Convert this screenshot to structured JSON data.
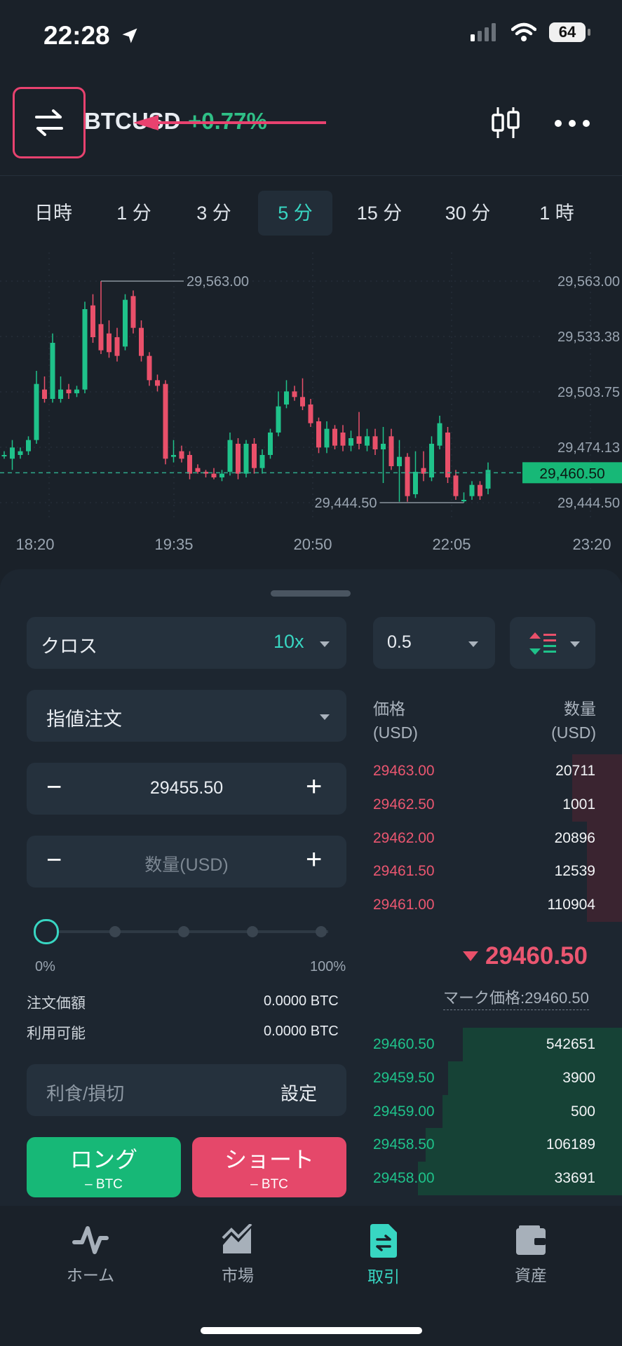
{
  "status": {
    "time": "22:28",
    "battery": "64"
  },
  "header": {
    "pair": "BTCUSD",
    "change": "+0.77%"
  },
  "timeframes": [
    {
      "label": "日時",
      "active": false
    },
    {
      "label": "1 分",
      "active": false
    },
    {
      "label": "3 分",
      "active": false
    },
    {
      "label": "5 分",
      "active": true
    },
    {
      "label": "15 分",
      "active": false
    },
    {
      "label": "30 分",
      "active": false
    },
    {
      "label": "1 時",
      "active": false
    }
  ],
  "chart_data": {
    "type": "candlestick",
    "y_ticks": [
      "29,563.00",
      "29,533.38",
      "29,503.75",
      "29,474.13",
      "29,444.50"
    ],
    "y_tick_values": [
      29563.0,
      29533.38,
      29503.75,
      29474.13,
      29444.5
    ],
    "x_ticks": [
      "18:20",
      "19:35",
      "20:50",
      "22:05",
      "23:20"
    ],
    "current_price": "29,460.50",
    "current_price_value": 29460.5,
    "high_label": "29,563.00",
    "high_value": 29563.0,
    "low_label": "29,444.50",
    "low_value": 29444.5,
    "ylim": [
      29444.5,
      29563.0
    ],
    "candles": [
      {
        "o": 29470,
        "c": 29470,
        "h": 29472,
        "l": 29468
      },
      {
        "o": 29468,
        "c": 29474,
        "h": 29478,
        "l": 29462
      },
      {
        "o": 29470,
        "c": 29472,
        "h": 29474,
        "l": 29468
      },
      {
        "o": 29472,
        "c": 29478,
        "h": 29480,
        "l": 29470
      },
      {
        "o": 29478,
        "c": 29508,
        "h": 29515,
        "l": 29476
      },
      {
        "o": 29505,
        "c": 29500,
        "h": 29512,
        "l": 29498
      },
      {
        "o": 29500,
        "c": 29530,
        "h": 29535,
        "l": 29498
      },
      {
        "o": 29500,
        "c": 29505,
        "h": 29512,
        "l": 29498
      },
      {
        "o": 29505,
        "c": 29503,
        "h": 29508,
        "l": 29500
      },
      {
        "o": 29503,
        "c": 29505,
        "h": 29507,
        "l": 29501
      },
      {
        "o": 29505,
        "c": 29548,
        "h": 29552,
        "l": 29503
      },
      {
        "o": 29550,
        "c": 29533,
        "h": 29556,
        "l": 29530
      },
      {
        "o": 29540,
        "c": 29526,
        "h": 29563,
        "l": 29524
      },
      {
        "o": 29535,
        "c": 29525,
        "h": 29542,
        "l": 29522
      },
      {
        "o": 29533,
        "c": 29523,
        "h": 29538,
        "l": 29520
      },
      {
        "o": 29528,
        "c": 29553,
        "h": 29556,
        "l": 29526
      },
      {
        "o": 29555,
        "c": 29538,
        "h": 29558,
        "l": 29535
      },
      {
        "o": 29538,
        "c": 29523,
        "h": 29542,
        "l": 29520
      },
      {
        "o": 29523,
        "c": 29510,
        "h": 29525,
        "l": 29507
      },
      {
        "o": 29510,
        "c": 29507,
        "h": 29513,
        "l": 29504
      },
      {
        "o": 29508,
        "c": 29468,
        "h": 29510,
        "l": 29465
      },
      {
        "o": 29469,
        "c": 29470,
        "h": 29478,
        "l": 29466
      },
      {
        "o": 29472,
        "c": 29468,
        "h": 29475,
        "l": 29466
      },
      {
        "o": 29470,
        "c": 29460,
        "h": 29472,
        "l": 29457
      },
      {
        "o": 29463,
        "c": 29461,
        "h": 29465,
        "l": 29460
      },
      {
        "o": 29461,
        "c": 29460,
        "h": 29462,
        "l": 29458
      },
      {
        "o": 29460,
        "c": 29458,
        "h": 29463,
        "l": 29457
      },
      {
        "o": 29458,
        "c": 29460,
        "h": 29462,
        "l": 29456
      },
      {
        "o": 29461,
        "c": 29478,
        "h": 29482,
        "l": 29459
      },
      {
        "o": 29476,
        "c": 29460,
        "h": 29479,
        "l": 29457
      },
      {
        "o": 29460,
        "c": 29476,
        "h": 29478,
        "l": 29458
      },
      {
        "o": 29476,
        "c": 29463,
        "h": 29479,
        "l": 29460
      },
      {
        "o": 29463,
        "c": 29470,
        "h": 29473,
        "l": 29460
      },
      {
        "o": 29470,
        "c": 29482,
        "h": 29484,
        "l": 29468
      },
      {
        "o": 29482,
        "c": 29496,
        "h": 29504,
        "l": 29480
      },
      {
        "o": 29497,
        "c": 29504,
        "h": 29510,
        "l": 29495
      },
      {
        "o": 29504,
        "c": 29501,
        "h": 29507,
        "l": 29499
      },
      {
        "o": 29501,
        "c": 29496,
        "h": 29511,
        "l": 29494
      },
      {
        "o": 29497,
        "c": 29487,
        "h": 29500,
        "l": 29485
      },
      {
        "o": 29488,
        "c": 29474,
        "h": 29490,
        "l": 29471
      },
      {
        "o": 29474,
        "c": 29484,
        "h": 29488,
        "l": 29471
      },
      {
        "o": 29484,
        "c": 29475,
        "h": 29486,
        "l": 29473
      },
      {
        "o": 29482,
        "c": 29475,
        "h": 29486,
        "l": 29472
      },
      {
        "o": 29475,
        "c": 29479,
        "h": 29483,
        "l": 29472
      },
      {
        "o": 29480,
        "c": 29476,
        "h": 29493,
        "l": 29473
      },
      {
        "o": 29475,
        "c": 29480,
        "h": 29484,
        "l": 29472
      },
      {
        "o": 29480,
        "c": 29473,
        "h": 29484,
        "l": 29470
      },
      {
        "o": 29473,
        "c": 29476,
        "h": 29485,
        "l": 29455
      },
      {
        "o": 29480,
        "c": 29464,
        "h": 29484,
        "l": 29462
      },
      {
        "o": 29464,
        "c": 29469,
        "h": 29478,
        "l": 29445
      },
      {
        "o": 29469,
        "c": 29448,
        "h": 29471,
        "l": 29445
      },
      {
        "o": 29449,
        "c": 29461,
        "h": 29472,
        "l": 29447
      },
      {
        "o": 29463,
        "c": 29460,
        "h": 29472,
        "l": 29456
      },
      {
        "o": 29458,
        "c": 29476,
        "h": 29480,
        "l": 29456
      },
      {
        "o": 29475,
        "c": 29487,
        "h": 29491,
        "l": 29473
      },
      {
        "o": 29482,
        "c": 29458,
        "h": 29485,
        "l": 29455
      },
      {
        "o": 29459,
        "c": 29448,
        "h": 29462,
        "l": 29446
      },
      {
        "o": 29446,
        "c": 29446,
        "h": 29450,
        "l": 29444.5
      },
      {
        "o": 29448,
        "c": 29454,
        "h": 29456,
        "l": 29446
      },
      {
        "o": 29454,
        "c": 29448,
        "h": 29456,
        "l": 29446
      },
      {
        "o": 29452,
        "c": 29462,
        "h": 29466,
        "l": 29449
      }
    ]
  },
  "order": {
    "margin_mode": "クロス",
    "leverage": "10x",
    "order_type": "指値注文",
    "price": "29455.50",
    "qty_placeholder": "数量(USD)",
    "slider_min": "0%",
    "slider_max": "100%",
    "slider_fraction": 0,
    "order_value_label": "注文価額",
    "order_value": "0.0000 BTC",
    "available_label": "利用可能",
    "available": "0.0000 BTC",
    "tpsl_label": "利食/損切",
    "tpsl_set": "設定",
    "long_label": "ロング",
    "long_sub": "– BTC",
    "short_label": "ショート",
    "short_sub": "– BTC"
  },
  "orderbook": {
    "depth_select": "0.5",
    "col_price": "価格",
    "col_price_unit": "(USD)",
    "col_qty": "数量",
    "col_qty_unit": "(USD)",
    "asks": [
      {
        "price": "29463.00",
        "qty": "20711",
        "depth": 0.2
      },
      {
        "price": "29462.50",
        "qty": "1001",
        "depth": 0.2
      },
      {
        "price": "29462.00",
        "qty": "20896",
        "depth": 0.14
      },
      {
        "price": "29461.50",
        "qty": "12539",
        "depth": 0.14
      },
      {
        "price": "29461.00",
        "qty": "110904",
        "depth": 0.14
      }
    ],
    "last_price": "29460.50",
    "mark_price": "マーク価格:29460.50",
    "bids": [
      {
        "price": "29460.50",
        "qty": "542651",
        "depth": 0.64
      },
      {
        "price": "29459.50",
        "qty": "3900",
        "depth": 0.7
      },
      {
        "price": "29459.00",
        "qty": "500",
        "depth": 0.72
      },
      {
        "price": "29458.50",
        "qty": "106189",
        "depth": 0.79
      },
      {
        "price": "29458.00",
        "qty": "33691",
        "depth": 0.82
      }
    ]
  },
  "tabs": [
    {
      "label": "ホーム",
      "active": false,
      "icon": "home-pulse-icon"
    },
    {
      "label": "市場",
      "active": false,
      "icon": "market-chart-icon"
    },
    {
      "label": "取引",
      "active": true,
      "icon": "trade-doc-icon"
    },
    {
      "label": "資産",
      "active": false,
      "icon": "wallet-icon"
    }
  ],
  "colors": {
    "up": "#1fc28a",
    "down": "#e9506a",
    "accent": "#38d6c2",
    "bg": "#1a2129"
  }
}
